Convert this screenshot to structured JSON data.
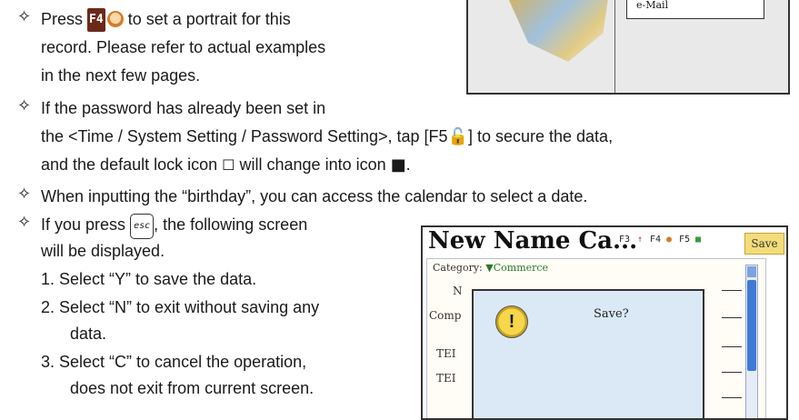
{
  "bullet_glyph": "✧",
  "item1": {
    "lines": [
      "to set a portrait for this",
      "record. Please refer to actual examples",
      "in the next few pages."
    ],
    "prefix": "Press",
    "key_label": "F4"
  },
  "item2": {
    "line1": "If the password has already been set in",
    "line2": "the <Time / System Setting / Password Setting>, tap [F5",
    "line2_tail": "] to secure the data,",
    "line3_a": "and the default lock icon",
    "line3_b": "will change into icon",
    "line3_end": "."
  },
  "item3": {
    "line1": "When inputting the “birthday”, you can access the calendar to select a date."
  },
  "item4": {
    "line1_a": "If you press",
    "line1_b": ", the following screen",
    "line2": "will be displayed.",
    "esc_label": "esc",
    "steps": [
      "1.  Select “Y” to save the data.",
      "2.  Select “N” to exit without saving any",
      "data.",
      "3.  Select “C” to cancel the operation,",
      "does not exit from current screen."
    ]
  },
  "screenshot_top": {
    "email_label": "e-Mail"
  },
  "screenshot_bottom": {
    "title": "New Name Ca...",
    "toolbar": "F3",
    "toolbar_f4": "F4",
    "toolbar_f5": "F5",
    "save_label": "Save",
    "category_label": "Category:",
    "category_value": "Commerce",
    "field_labels": [
      "N",
      "Comp",
      "TEI",
      "TEI"
    ],
    "dialog_question": "Save?",
    "warning_glyph": "!"
  },
  "colors": {
    "text": "#1a1a1a",
    "save_button": "#f3dc7a",
    "dialog_bg": "#dbe9f7",
    "scroll_thumb": "#3f7ad6"
  }
}
